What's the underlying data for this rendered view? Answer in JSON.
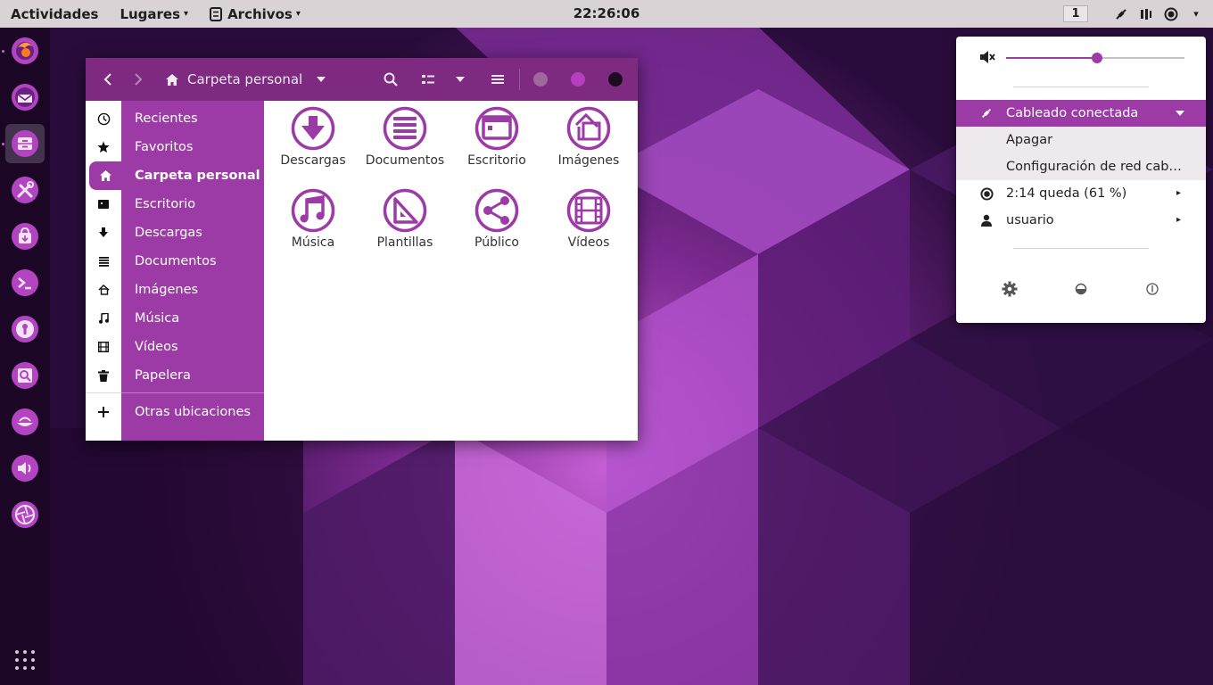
{
  "topbar": {
    "activities": "Actividades",
    "places": "Lugares",
    "app_menu": "Archivos",
    "clock": "22:26:06",
    "workspace": "1",
    "caret": "▾"
  },
  "dock": {
    "apps": [
      {
        "name": "firefox-icon"
      },
      {
        "name": "thunderbird-icon"
      },
      {
        "name": "files-icon"
      },
      {
        "name": "settings-tools-icon"
      },
      {
        "name": "software-bag-icon"
      },
      {
        "name": "terminal-icon"
      },
      {
        "name": "keyring-icon"
      },
      {
        "name": "image-viewer-icon"
      },
      {
        "name": "gedit-icon"
      },
      {
        "name": "volume-icon"
      },
      {
        "name": "aperture-icon"
      }
    ]
  },
  "file_manager": {
    "path": "Carpeta personal",
    "sidebar": [
      {
        "label": "Recientes",
        "icon": "clock-icon"
      },
      {
        "label": "Favoritos",
        "icon": "star-icon"
      },
      {
        "label": "Carpeta personal",
        "icon": "home-icon"
      },
      {
        "label": "Escritorio",
        "icon": "desktop-icon"
      },
      {
        "label": "Descargas",
        "icon": "download-icon"
      },
      {
        "label": "Documentos",
        "icon": "documents-icon"
      },
      {
        "label": "Imágenes",
        "icon": "images-icon"
      },
      {
        "label": "Música",
        "icon": "music-icon"
      },
      {
        "label": "Vídeos",
        "icon": "videos-icon"
      },
      {
        "label": "Papelera",
        "icon": "trash-icon"
      }
    ],
    "other_locations": "Otras ubicaciones",
    "folders": [
      {
        "label": "Descargas",
        "icon": "download-folder-icon"
      },
      {
        "label": "Documentos",
        "icon": "documents-folder-icon"
      },
      {
        "label": "Escritorio",
        "icon": "desktop-folder-icon"
      },
      {
        "label": "Imágenes",
        "icon": "images-folder-icon"
      },
      {
        "label": "Música",
        "icon": "music-folder-icon"
      },
      {
        "label": "Plantillas",
        "icon": "templates-folder-icon"
      },
      {
        "label": "Público",
        "icon": "public-folder-icon"
      },
      {
        "label": "Vídeos",
        "icon": "videos-folder-icon"
      }
    ]
  },
  "system_menu": {
    "volume_level": 0.51,
    "wired": "Cableado conectada",
    "turn_off": "Apagar",
    "wired_settings": "Configuración de red cableada",
    "battery": "2:14 queda (61 %)",
    "user": "usuario",
    "arrow": "▸",
    "caret": "▾"
  },
  "colors": {
    "accent": "#9c3ba6",
    "header": "#7e2a80",
    "topbar": "#d9d3d6"
  }
}
